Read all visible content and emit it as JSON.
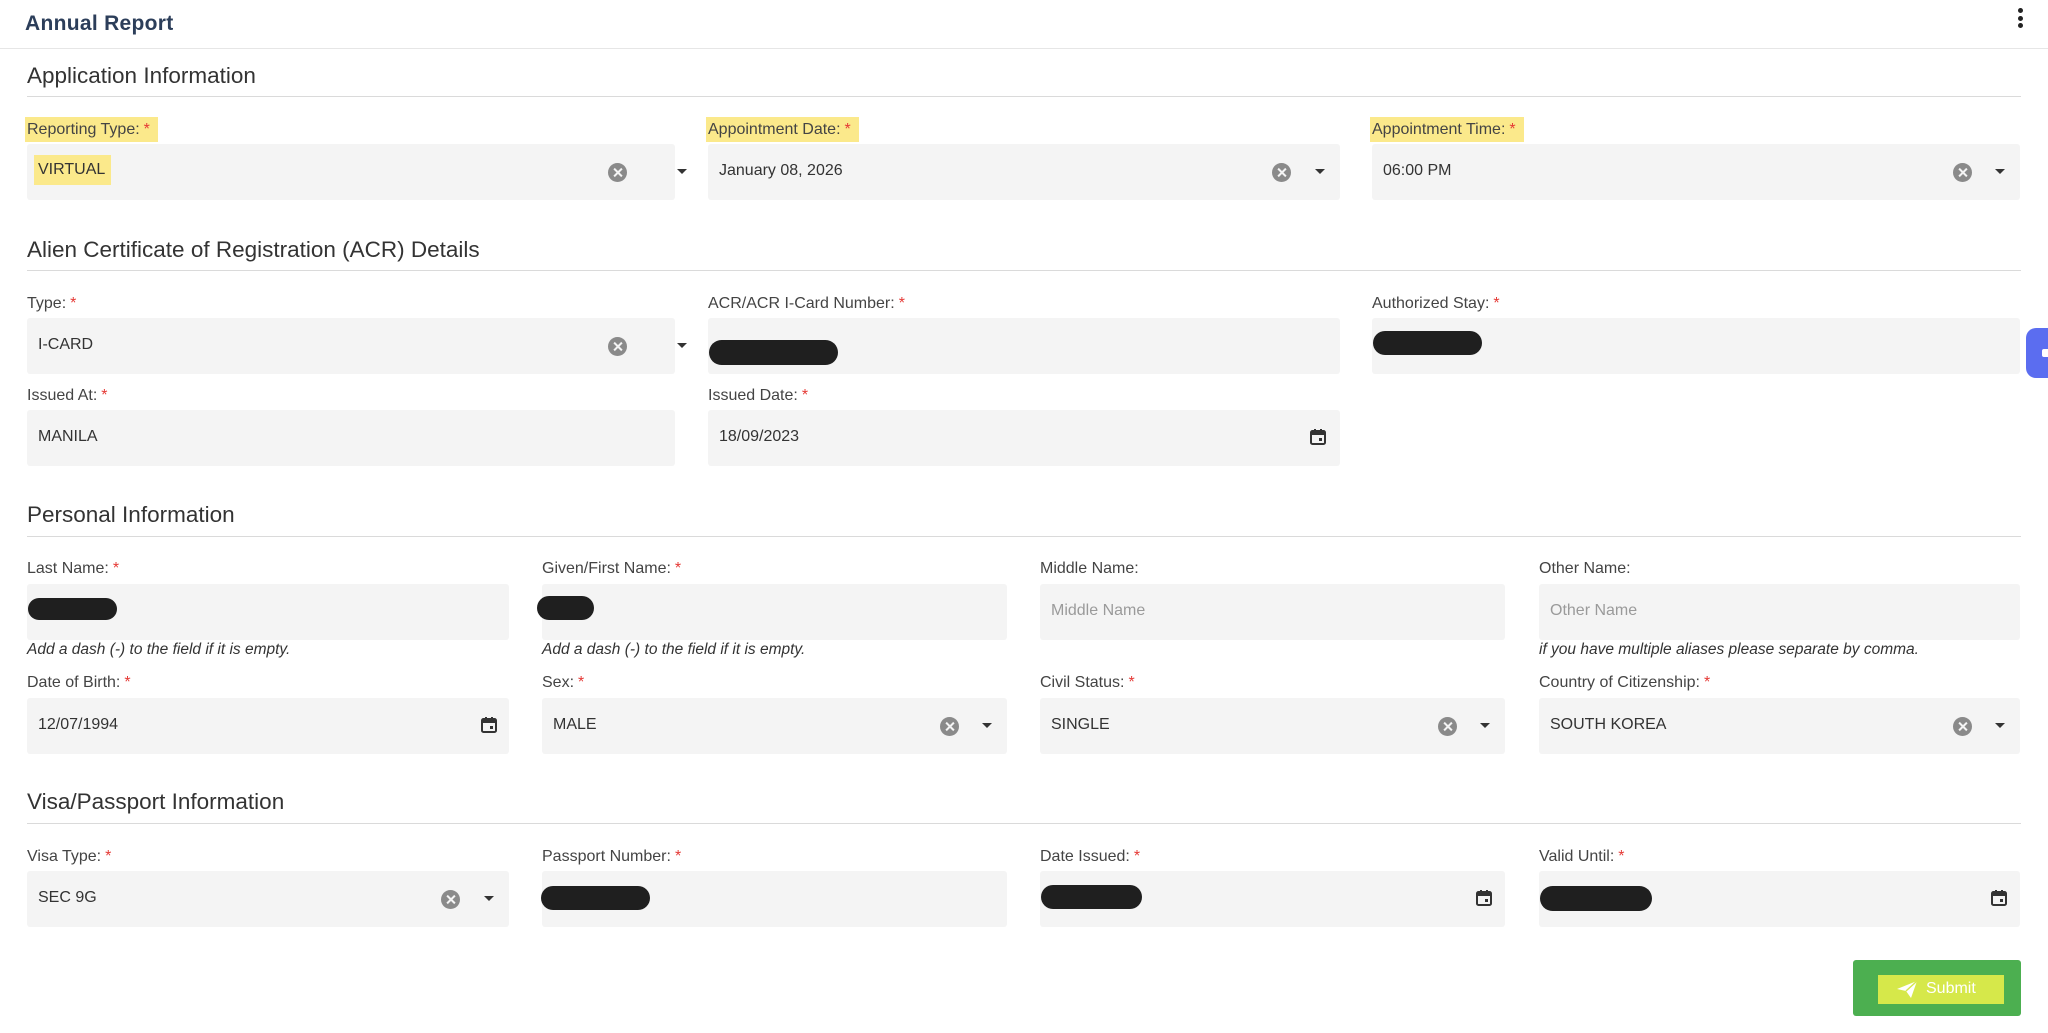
{
  "header": {
    "title": "Annual Report",
    "menu_icon": "kebab-menu-icon"
  },
  "required_marker": "*",
  "sections": {
    "application": "Application Information",
    "acr": "Alien Certificate of Registration (ACR) Details",
    "personal": "Personal Information",
    "visa": "Visa/Passport Information"
  },
  "fields": {
    "reporting_type": {
      "label": "Reporting Type:",
      "value": "VIRTUAL"
    },
    "appointment_date": {
      "label": "Appointment Date:",
      "value": "January 08, 2026"
    },
    "appointment_time": {
      "label": "Appointment Time:",
      "value": "06:00 PM"
    },
    "acr_type": {
      "label": "Type:",
      "value": "I-CARD"
    },
    "acr_number": {
      "label": "ACR/ACR I-Card Number:"
    },
    "authorized_stay": {
      "label": "Authorized Stay:"
    },
    "issued_at": {
      "label": "Issued At:",
      "value": "MANILA"
    },
    "issued_date": {
      "label": "Issued Date:",
      "value": "18/09/2023"
    },
    "last_name": {
      "label": "Last Name:",
      "hint": "Add a dash (-) to the field if it is empty."
    },
    "first_name": {
      "label": "Given/First Name:",
      "hint": "Add a dash (-) to the field if it is empty."
    },
    "middle_name": {
      "label": "Middle Name:",
      "placeholder": "Middle Name"
    },
    "other_name": {
      "label": "Other Name:",
      "placeholder": "Other Name",
      "hint": "if you have multiple aliases please separate by comma."
    },
    "dob": {
      "label": "Date of Birth:",
      "value": "12/07/1994"
    },
    "sex": {
      "label": "Sex:",
      "value": "MALE"
    },
    "civil_status": {
      "label": "Civil Status:",
      "value": "SINGLE"
    },
    "citizenship": {
      "label": "Country of Citizenship:",
      "value": "SOUTH KOREA"
    },
    "visa_type": {
      "label": "Visa Type:",
      "value": "SEC 9G"
    },
    "passport_number": {
      "label": "Passport Number:"
    },
    "date_issued": {
      "label": "Date Issued:"
    },
    "valid_until": {
      "label": "Valid Until:"
    }
  },
  "submit": {
    "label": "Submit",
    "icon": "send-icon"
  },
  "colors": {
    "highlight": "#fbe98b",
    "submit_bg": "#4caf50",
    "required": "#e53935",
    "side_tab": "#5b6df0"
  }
}
